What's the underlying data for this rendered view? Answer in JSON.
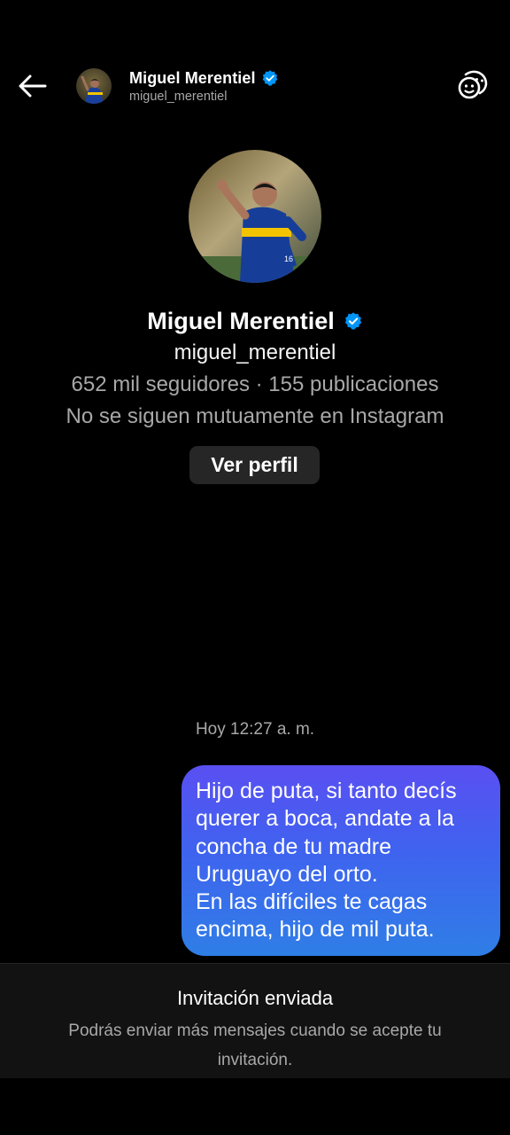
{
  "header": {
    "name": "Miguel Merentiel",
    "username": "miguel_merentiel",
    "back_icon": "arrow-left-icon",
    "verified_icon": "verified-badge-icon",
    "sticker_icon": "sticker-icon"
  },
  "profile": {
    "name": "Miguel Merentiel",
    "username": "miguel_merentiel",
    "stats": "652 mil seguidores · 155 publicaciones",
    "mutual": "No se siguen mutuamente en Instagram",
    "view_profile_label": "Ver perfil"
  },
  "conversation": {
    "timestamp": "Hoy 12:27 a. m.",
    "messages": [
      {
        "from": "me",
        "lines": [
          "Hijo de puta, si tanto decís",
          "querer a boca, andate a la",
          "concha de tu madre",
          "Uruguayo del orto.",
          "En las difíciles te cagas",
          "encima, hijo de mil puta."
        ]
      }
    ]
  },
  "footer": {
    "title": "Invitación enviada",
    "description": "Podrás enviar más mensajes cuando se acepte tu invitación."
  },
  "colors": {
    "background": "#000000",
    "secondary_text": "#a8a8a8",
    "verified_blue": "#0095f6",
    "button_bg": "#262626",
    "bubble_gradient_top": "#5a4ff2",
    "bubble_gradient_bottom": "#2f7ee6",
    "footer_bg": "#121212"
  }
}
